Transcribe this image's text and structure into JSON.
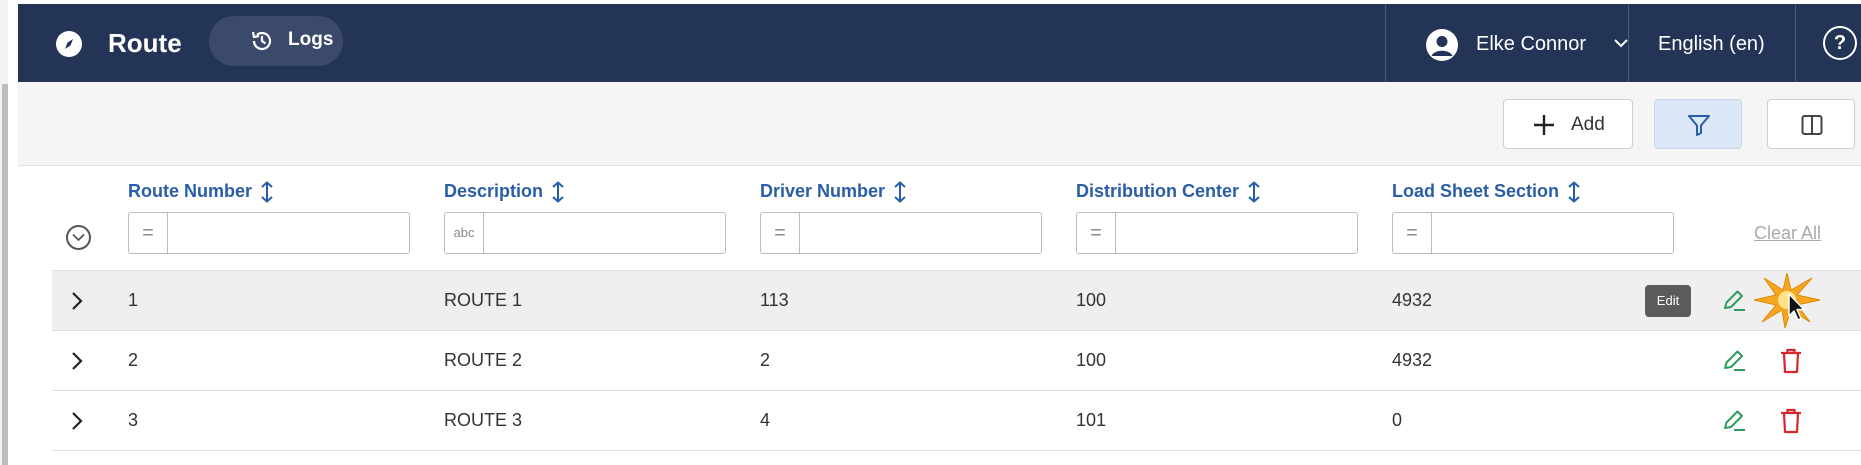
{
  "header": {
    "title": "Route",
    "logs_label": "Logs",
    "user_name": "Elke Connor",
    "language": "English (en)",
    "help_glyph": "?"
  },
  "toolbar": {
    "add_label": "Add"
  },
  "table": {
    "columns": [
      {
        "label": "Route Number",
        "filter_operator": "=",
        "filter_value": ""
      },
      {
        "label": "Description",
        "filter_operator": "abc",
        "filter_value": ""
      },
      {
        "label": "Driver Number",
        "filter_operator": "=",
        "filter_value": ""
      },
      {
        "label": "Distribution Center",
        "filter_operator": "=",
        "filter_value": ""
      },
      {
        "label": "Load Sheet Section",
        "filter_operator": "=",
        "filter_value": ""
      }
    ],
    "clear_all_label": "Clear All",
    "rows": [
      {
        "route_number": "1",
        "description": "ROUTE 1",
        "driver_number": "113",
        "distribution_center": "100",
        "load_sheet_section": "4932"
      },
      {
        "route_number": "2",
        "description": "ROUTE 2",
        "driver_number": "2",
        "distribution_center": "100",
        "load_sheet_section": "4932"
      },
      {
        "route_number": "3",
        "description": "ROUTE 3",
        "driver_number": "4",
        "distribution_center": "101",
        "load_sheet_section": "0"
      }
    ],
    "edit_tooltip": "Edit"
  },
  "colors": {
    "nav_background": "#243457",
    "header_text": "#2a5da8",
    "edit_icon": "#2e9c5e",
    "delete_icon": "#d6262e",
    "filter_active": "#dbe8f7"
  },
  "icons": [
    "compass-icon",
    "history-icon",
    "user-avatar-icon",
    "chevron-down-icon",
    "help-icon",
    "plus-icon",
    "filter-icon",
    "columns-icon",
    "sort-icon",
    "expand-all-icon",
    "chevron-right-icon",
    "edit-icon",
    "delete-icon",
    "mouse-pointer-icon"
  ]
}
